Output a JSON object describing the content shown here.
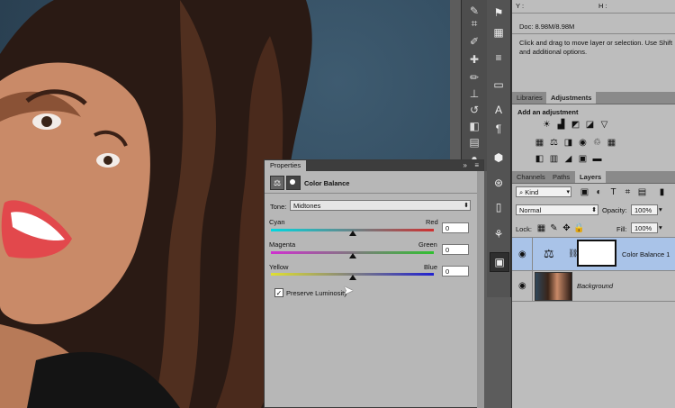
{
  "info_panel": {
    "doc_label": "Doc: 8.98M/8.98M",
    "hint": "Click and drag to move layer or selection.  Use Shift and additional options.",
    "coord_y": "Y :",
    "coord_h": "H :"
  },
  "adjust_panel": {
    "tabs": [
      "Libraries",
      "Adjustments"
    ],
    "active_tab": "Adjustments",
    "title": "Add an adjustment"
  },
  "layers_panel": {
    "tabs": [
      "Channels",
      "Paths",
      "Layers"
    ],
    "active_tab": "Layers",
    "filter_kind": "Kind",
    "blend_mode": "Normal",
    "opacity_label": "Opacity:",
    "opacity": "100%",
    "lock_label": "Lock:",
    "fill_label": "Fill:",
    "fill": "100%",
    "layers": [
      {
        "name": "Color Balance 1",
        "selected": true
      },
      {
        "name": "Background",
        "selected": false
      }
    ]
  },
  "properties": {
    "tab": "Properties",
    "title": "Color Balance",
    "tone_label": "Tone:",
    "tone_value": "Midtones",
    "sliders": [
      {
        "left": "Cyan",
        "right": "Red",
        "value": "0",
        "position": 0.5
      },
      {
        "left": "Magenta",
        "right": "Green",
        "value": "0",
        "position": 0.5
      },
      {
        "left": "Yellow",
        "right": "Blue",
        "value": "0",
        "position": 0.5
      }
    ],
    "preserve_label": "Preserve Luminosity",
    "preserve_checked": true
  },
  "colors": {
    "accent_selection": "#a9c3e8",
    "panel": "#bdbdbd",
    "dark": "#4d4d4d"
  }
}
